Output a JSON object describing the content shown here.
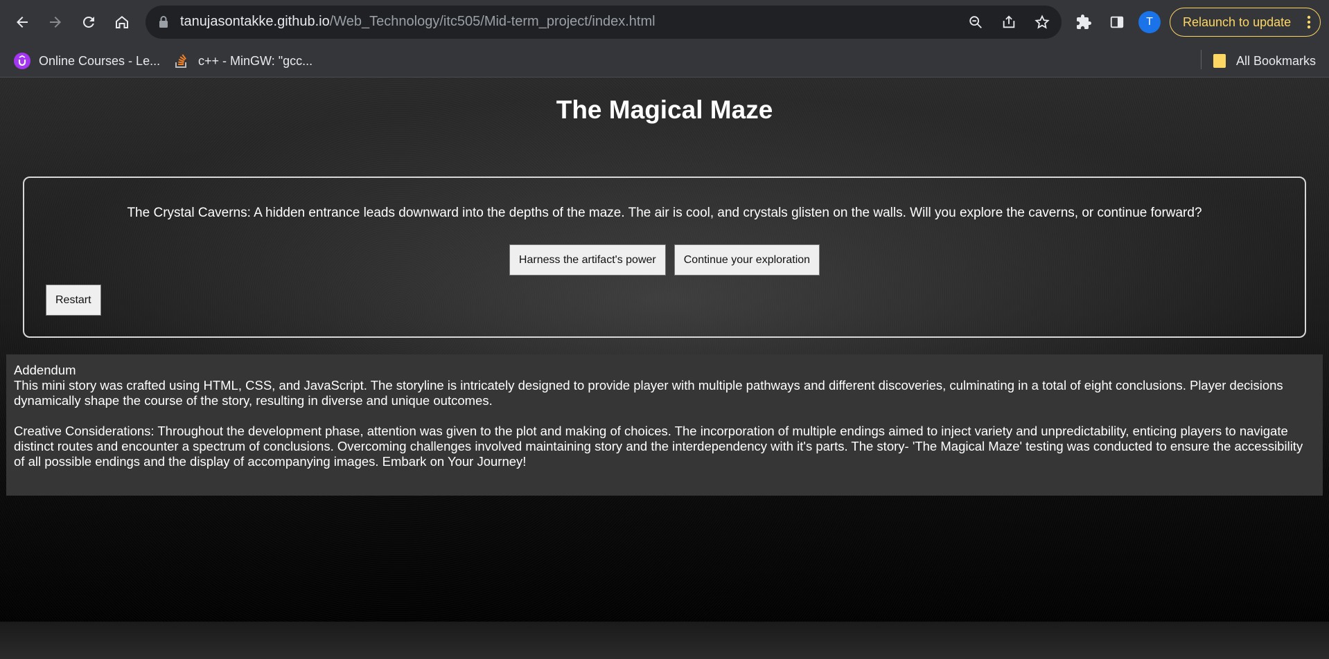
{
  "browser": {
    "url_host": "tanujasontakke.github.io",
    "url_path": "/Web_Technology/itc505/Mid-term_project/index.html",
    "profile_initial": "T",
    "relaunch_label": "Relaunch to update",
    "bookmarks": [
      {
        "label": "Online Courses - Le...",
        "icon": "udemy-icon"
      },
      {
        "label": "c++ - MinGW: \"gcc...",
        "icon": "stackoverflow-icon"
      }
    ],
    "all_bookmarks_label": "All Bookmarks"
  },
  "page": {
    "title": "The Magical Maze",
    "story_text": "The Crystal Caverns: A hidden entrance leads downward into the depths of the maze. The air is cool, and crystals glisten on the walls. Will you explore the caverns, or continue forward?",
    "choices": [
      "Harness the artifact's power",
      "Continue your exploration"
    ],
    "restart_label": "Restart",
    "addendum": {
      "heading": "Addendum",
      "paragraph1": "This mini story was crafted using HTML, CSS, and JavaScript. The storyline is intricately designed to provide player with multiple pathways and different discoveries, culminating in a total of eight conclusions. Player decisions dynamically shape the course of the story, resulting in diverse and unique outcomes.",
      "paragraph2": "Creative Considerations: Throughout the development phase, attention was given to the plot and making of choices. The incorporation of multiple endings aimed to inject variety and unpredictability, enticing players to navigate distinct routes and encounter a spectrum of conclusions. Overcoming challenges involved maintaining story and the interdependency with it's parts. The story- 'The Magical Maze' testing was conducted to ensure the accessibility of all possible endings and the display of accompanying images. Embark on Your Journey!"
    }
  },
  "colors": {
    "chrome_bg": "#35363a",
    "omnibox_bg": "#202124",
    "relaunch_accent": "#fdd663",
    "avatar_bg": "#1a73e8",
    "addendum_bg": "#363636"
  }
}
